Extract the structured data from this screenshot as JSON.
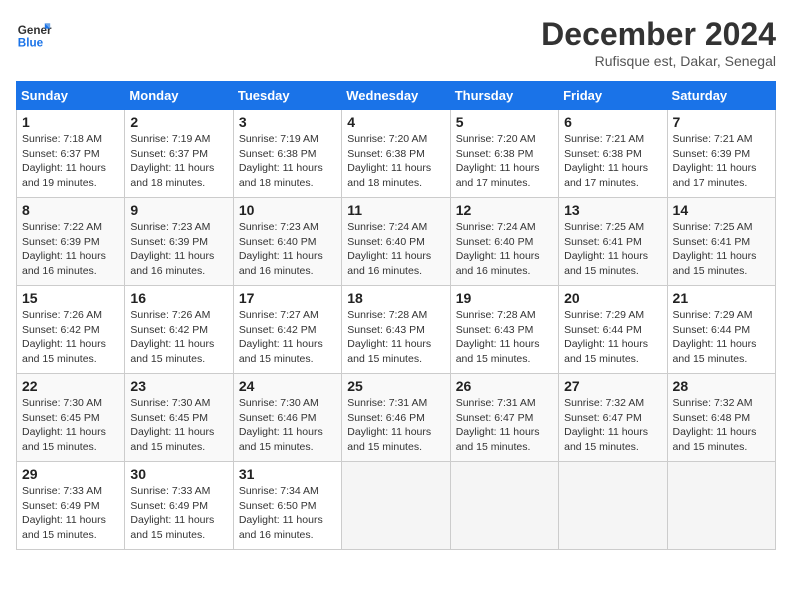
{
  "logo": {
    "line1": "General",
    "line2": "Blue"
  },
  "title": "December 2024",
  "subtitle": "Rufisque est, Dakar, Senegal",
  "days_header": [
    "Sunday",
    "Monday",
    "Tuesday",
    "Wednesday",
    "Thursday",
    "Friday",
    "Saturday"
  ],
  "weeks": [
    [
      {
        "day": "1",
        "info": "Sunrise: 7:18 AM\nSunset: 6:37 PM\nDaylight: 11 hours\nand 19 minutes."
      },
      {
        "day": "2",
        "info": "Sunrise: 7:19 AM\nSunset: 6:37 PM\nDaylight: 11 hours\nand 18 minutes."
      },
      {
        "day": "3",
        "info": "Sunrise: 7:19 AM\nSunset: 6:38 PM\nDaylight: 11 hours\nand 18 minutes."
      },
      {
        "day": "4",
        "info": "Sunrise: 7:20 AM\nSunset: 6:38 PM\nDaylight: 11 hours\nand 18 minutes."
      },
      {
        "day": "5",
        "info": "Sunrise: 7:20 AM\nSunset: 6:38 PM\nDaylight: 11 hours\nand 17 minutes."
      },
      {
        "day": "6",
        "info": "Sunrise: 7:21 AM\nSunset: 6:38 PM\nDaylight: 11 hours\nand 17 minutes."
      },
      {
        "day": "7",
        "info": "Sunrise: 7:21 AM\nSunset: 6:39 PM\nDaylight: 11 hours\nand 17 minutes."
      }
    ],
    [
      {
        "day": "8",
        "info": "Sunrise: 7:22 AM\nSunset: 6:39 PM\nDaylight: 11 hours\nand 16 minutes."
      },
      {
        "day": "9",
        "info": "Sunrise: 7:23 AM\nSunset: 6:39 PM\nDaylight: 11 hours\nand 16 minutes."
      },
      {
        "day": "10",
        "info": "Sunrise: 7:23 AM\nSunset: 6:40 PM\nDaylight: 11 hours\nand 16 minutes."
      },
      {
        "day": "11",
        "info": "Sunrise: 7:24 AM\nSunset: 6:40 PM\nDaylight: 11 hours\nand 16 minutes."
      },
      {
        "day": "12",
        "info": "Sunrise: 7:24 AM\nSunset: 6:40 PM\nDaylight: 11 hours\nand 16 minutes."
      },
      {
        "day": "13",
        "info": "Sunrise: 7:25 AM\nSunset: 6:41 PM\nDaylight: 11 hours\nand 15 minutes."
      },
      {
        "day": "14",
        "info": "Sunrise: 7:25 AM\nSunset: 6:41 PM\nDaylight: 11 hours\nand 15 minutes."
      }
    ],
    [
      {
        "day": "15",
        "info": "Sunrise: 7:26 AM\nSunset: 6:42 PM\nDaylight: 11 hours\nand 15 minutes."
      },
      {
        "day": "16",
        "info": "Sunrise: 7:26 AM\nSunset: 6:42 PM\nDaylight: 11 hours\nand 15 minutes."
      },
      {
        "day": "17",
        "info": "Sunrise: 7:27 AM\nSunset: 6:42 PM\nDaylight: 11 hours\nand 15 minutes."
      },
      {
        "day": "18",
        "info": "Sunrise: 7:28 AM\nSunset: 6:43 PM\nDaylight: 11 hours\nand 15 minutes."
      },
      {
        "day": "19",
        "info": "Sunrise: 7:28 AM\nSunset: 6:43 PM\nDaylight: 11 hours\nand 15 minutes."
      },
      {
        "day": "20",
        "info": "Sunrise: 7:29 AM\nSunset: 6:44 PM\nDaylight: 11 hours\nand 15 minutes."
      },
      {
        "day": "21",
        "info": "Sunrise: 7:29 AM\nSunset: 6:44 PM\nDaylight: 11 hours\nand 15 minutes."
      }
    ],
    [
      {
        "day": "22",
        "info": "Sunrise: 7:30 AM\nSunset: 6:45 PM\nDaylight: 11 hours\nand 15 minutes."
      },
      {
        "day": "23",
        "info": "Sunrise: 7:30 AM\nSunset: 6:45 PM\nDaylight: 11 hours\nand 15 minutes."
      },
      {
        "day": "24",
        "info": "Sunrise: 7:30 AM\nSunset: 6:46 PM\nDaylight: 11 hours\nand 15 minutes."
      },
      {
        "day": "25",
        "info": "Sunrise: 7:31 AM\nSunset: 6:46 PM\nDaylight: 11 hours\nand 15 minutes."
      },
      {
        "day": "26",
        "info": "Sunrise: 7:31 AM\nSunset: 6:47 PM\nDaylight: 11 hours\nand 15 minutes."
      },
      {
        "day": "27",
        "info": "Sunrise: 7:32 AM\nSunset: 6:47 PM\nDaylight: 11 hours\nand 15 minutes."
      },
      {
        "day": "28",
        "info": "Sunrise: 7:32 AM\nSunset: 6:48 PM\nDaylight: 11 hours\nand 15 minutes."
      }
    ],
    [
      {
        "day": "29",
        "info": "Sunrise: 7:33 AM\nSunset: 6:49 PM\nDaylight: 11 hours\nand 15 minutes."
      },
      {
        "day": "30",
        "info": "Sunrise: 7:33 AM\nSunset: 6:49 PM\nDaylight: 11 hours\nand 15 minutes."
      },
      {
        "day": "31",
        "info": "Sunrise: 7:34 AM\nSunset: 6:50 PM\nDaylight: 11 hours\nand 16 minutes."
      },
      {
        "day": "",
        "info": ""
      },
      {
        "day": "",
        "info": ""
      },
      {
        "day": "",
        "info": ""
      },
      {
        "day": "",
        "info": ""
      }
    ]
  ]
}
